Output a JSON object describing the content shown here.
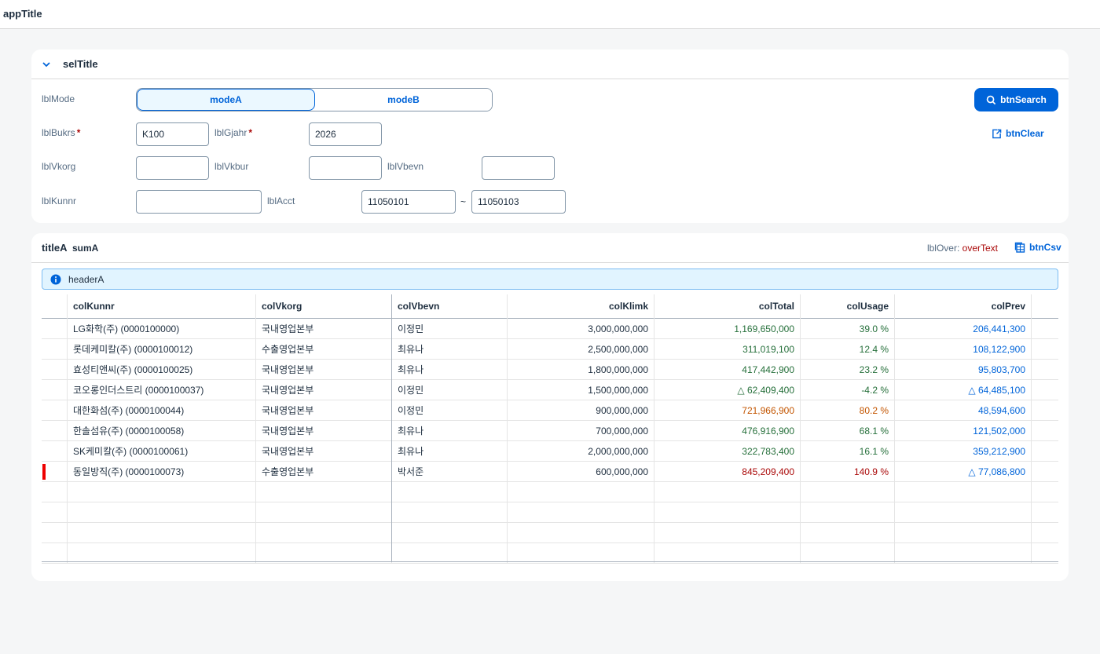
{
  "app": {
    "title": "appTitle"
  },
  "filter": {
    "title": "selTitle",
    "mode_label": "lblMode",
    "modes": [
      "modeA",
      "modeB"
    ],
    "active_mode": "modeA",
    "bukrs_label": "lblBukrs",
    "bukrs_value": "K100",
    "gjahr_label": "lblGjahr",
    "gjahr_value": "2026",
    "required_mark": "*",
    "vkorg_label": "lblVkorg",
    "vkorg_value": "",
    "vkbur_label": "lblVkbur",
    "vkbur_value": "",
    "vbevn_label": "lblVbevn",
    "vbevn_value": "",
    "kunnr_label": "lblKunnr",
    "kunnr_value": "",
    "acct_label": "lblAcct",
    "acct_from": "11050101",
    "acct_sep": "~",
    "acct_to": "11050103",
    "search_label": "btnSearch",
    "clear_label": "btnClear"
  },
  "table": {
    "title": "titleA",
    "sum": "sumA",
    "over_label": "lblOver:",
    "over_text": "overText",
    "csv_label": "btnCsv",
    "info_text": "headerA",
    "columns": [
      "colKunnr",
      "colVkorg",
      "colVbevn",
      "colKlimk",
      "colTotal",
      "colUsage",
      "colPrev"
    ],
    "rows": [
      {
        "kunnr": "LG화학(주) (0000100000)",
        "vkorg": "국내영업본부",
        "vbevn": "이정민",
        "klimk": "3,000,000,000",
        "total": "1,169,650,000",
        "usage": "39.0 %",
        "prev": "206,441,300",
        "status": "g",
        "prev_neg": false,
        "flag": false
      },
      {
        "kunnr": "롯데케미칼(주) (0000100012)",
        "vkorg": "수출영업본부",
        "vbevn": "최유나",
        "klimk": "2,500,000,000",
        "total": "311,019,100",
        "usage": "12.4 %",
        "prev": "108,122,900",
        "status": "g",
        "prev_neg": false,
        "flag": false
      },
      {
        "kunnr": "효성티앤씨(주) (0000100025)",
        "vkorg": "국내영업본부",
        "vbevn": "최유나",
        "klimk": "1,800,000,000",
        "total": "417,442,900",
        "usage": "23.2 %",
        "prev": "95,803,700",
        "status": "g",
        "prev_neg": false,
        "flag": false
      },
      {
        "kunnr": "코오롱인더스트리 (0000100037)",
        "vkorg": "국내영업본부",
        "vbevn": "이정민",
        "klimk": "1,500,000,000",
        "total": "△ 62,409,400",
        "usage": "-4.2 %",
        "prev": "△ 64,485,100",
        "status": "g",
        "prev_neg": true,
        "flag": false
      },
      {
        "kunnr": "대한화섬(주) (0000100044)",
        "vkorg": "국내영업본부",
        "vbevn": "이정민",
        "klimk": "900,000,000",
        "total": "721,966,900",
        "usage": "80.2 %",
        "prev": "48,594,600",
        "status": "o",
        "prev_neg": false,
        "flag": false
      },
      {
        "kunnr": "한솔섬유(주) (0000100058)",
        "vkorg": "국내영업본부",
        "vbevn": "최유나",
        "klimk": "700,000,000",
        "total": "476,916,900",
        "usage": "68.1 %",
        "prev": "121,502,000",
        "status": "g",
        "prev_neg": false,
        "flag": false
      },
      {
        "kunnr": "SK케미칼(주) (0000100061)",
        "vkorg": "국내영업본부",
        "vbevn": "최유나",
        "klimk": "2,000,000,000",
        "total": "322,783,400",
        "usage": "16.1 %",
        "prev": "359,212,900",
        "status": "g",
        "prev_neg": false,
        "flag": false
      },
      {
        "kunnr": "동일방직(주) (0000100073)",
        "vkorg": "수출영업본부",
        "vbevn": "박서준",
        "klimk": "600,000,000",
        "total": "845,209,400",
        "usage": "140.9 %",
        "prev": "△ 77,086,800",
        "status": "rd",
        "prev_neg": true,
        "flag": true
      }
    ]
  },
  "colors": {
    "accent": "#0064d9",
    "positive": "#256f3a",
    "warning": "#c35500",
    "critical": "#aa0808"
  },
  "icons": {
    "collapse": "chevron-down-icon",
    "search": "search-icon",
    "clear": "clear-icon",
    "csv": "spreadsheet-icon",
    "info": "info-icon"
  }
}
